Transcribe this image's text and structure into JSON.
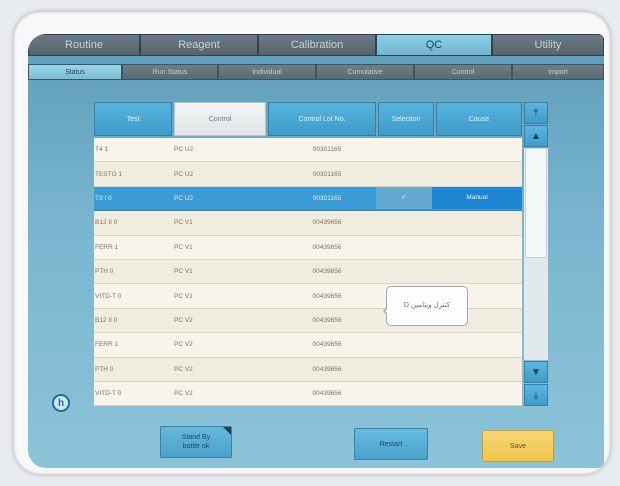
{
  "top_tabs": [
    "Routine",
    "Reagent",
    "Calibration",
    "QC",
    "Utility"
  ],
  "top_active": 3,
  "sub_tabs": [
    "Status",
    "Run Status",
    "Individual",
    "Cumulative",
    "Control",
    "Import"
  ],
  "sub_active": 0,
  "columns": [
    "Test",
    "Control",
    "Control Lot No.",
    "Selection",
    "Cause"
  ],
  "active_column": 1,
  "rows": [
    {
      "test": "T4 1",
      "control": "PC U2",
      "lot": "00301165",
      "selection": "",
      "cause": ""
    },
    {
      "test": "TESTO 1",
      "control": "PC U2",
      "lot": "00301165",
      "selection": "",
      "cause": ""
    },
    {
      "test": "T3 I 0",
      "control": "PC U2",
      "lot": "00301165",
      "selection": "✓",
      "cause": "Manual"
    },
    {
      "test": "B12 II 0",
      "control": "PC V1",
      "lot": "00439656",
      "selection": "",
      "cause": ""
    },
    {
      "test": "FERR 1",
      "control": "PC V1",
      "lot": "00439656",
      "selection": "",
      "cause": ""
    },
    {
      "test": "PTH 0",
      "control": "PC V1",
      "lot": "00439656",
      "selection": "",
      "cause": ""
    },
    {
      "test": "VITD-T 0",
      "control": "PC V1",
      "lot": "00439656",
      "selection": "",
      "cause": ""
    },
    {
      "test": "B12 II 0",
      "control": "PC V2",
      "lot": "00439656",
      "selection": "",
      "cause": ""
    },
    {
      "test": "FERR 1",
      "control": "PC V2",
      "lot": "00439656",
      "selection": "",
      "cause": ""
    },
    {
      "test": "PTH 0",
      "control": "PC V2",
      "lot": "00439656",
      "selection": "",
      "cause": ""
    },
    {
      "test": "VITD-T 0",
      "control": "PC V2",
      "lot": "00439656",
      "selection": "",
      "cause": ""
    }
  ],
  "selected_row": 2,
  "tooltip": "کنترل ویتامین D",
  "help_label": "h",
  "buttons": {
    "standby": "Stand By\nbottle ok",
    "restart": "Restart",
    "save": "Save"
  },
  "scroll": {
    "top_top": "⤒",
    "up": "▲",
    "down": "▼",
    "bottom": "⤓"
  }
}
